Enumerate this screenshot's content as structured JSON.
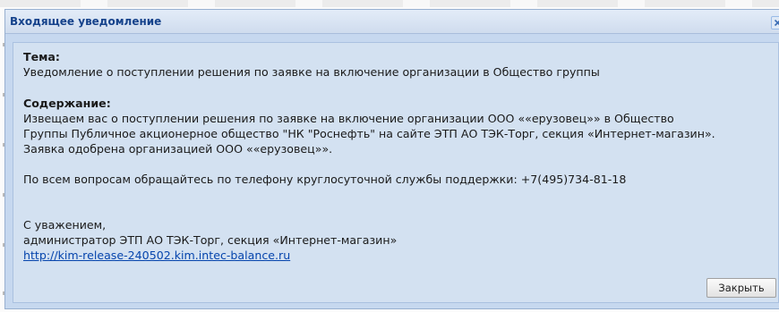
{
  "dialog": {
    "title": "Входящее уведомление",
    "close_icon": "close-icon",
    "subject_label": "Тема:",
    "subject_text": "Уведомление о поступлении решения по заявке на включение организации в Общество группы",
    "content_label": "Содержание:",
    "body_lines": [
      "Извещаем вас о поступлении решения по заявке на включение организации ООО ««ерузовец»» в Общество",
      "Группы Публичное акционерное общество \"НК \"Роснефть\" на сайте ЭТП АО ТЭК-Торг, секция «Интернет-магазин».",
      "Заявка одобрена организацией ООО ««ерузовец»»."
    ],
    "support_text": "По всем вопросам обращайтесь по телефону круглосуточной службы поддержки: +7(495)734-81-18",
    "signature_lines": [
      "С уважением,",
      "администратор ЭТП АО ТЭК-Торг, секция «Интернет-магазин»"
    ],
    "link_text": "http://kim-release-240502.kim.intec-balance.ru",
    "close_button_label": "Закрыть"
  },
  "colors": {
    "title_text": "#15428b",
    "dialog_frame": "#c6d8ef",
    "content_background": "#d3e1f1",
    "link": "#0645ad"
  }
}
